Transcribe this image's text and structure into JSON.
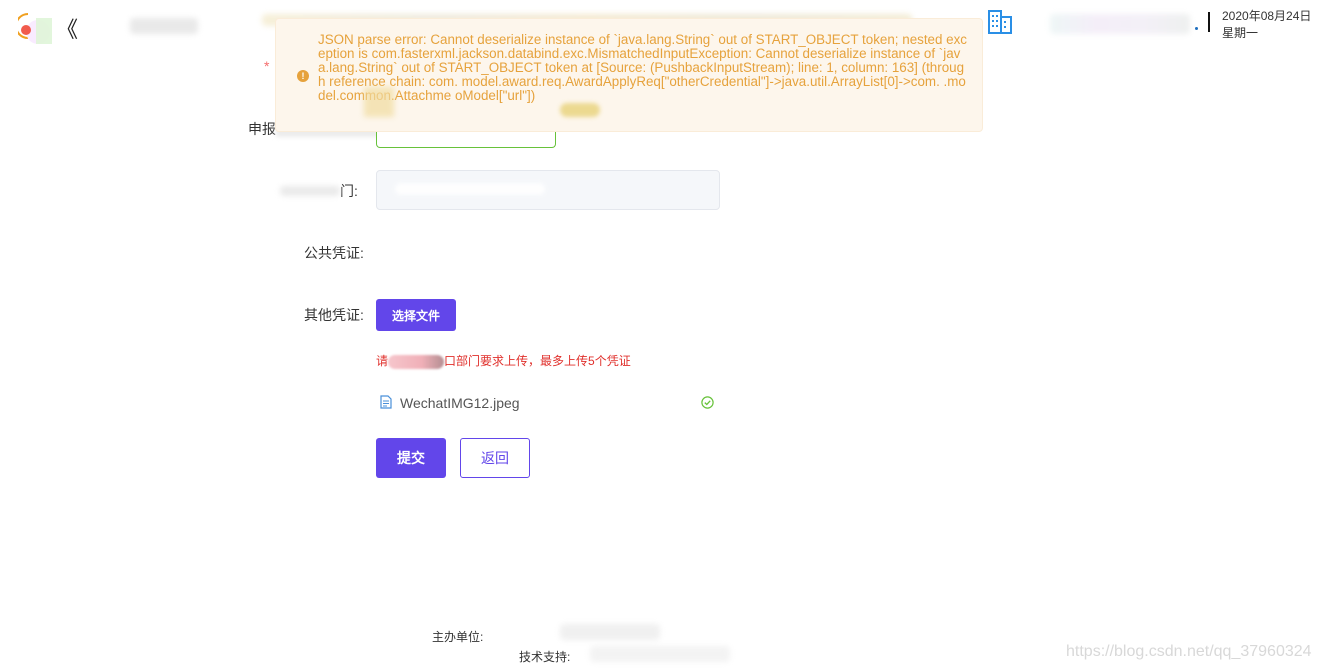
{
  "header": {
    "date": "2020年08月24日",
    "weekday": "星期一",
    "back_icon": "《"
  },
  "toast": {
    "type": "warning",
    "icon": "!",
    "message": "JSON parse error: Cannot deserialize instance of `java.lang.String` out of START_OBJECT token; nested exception is com.fasterxml.jackson.databind.exc.MismatchedInputException: Cannot deserialize instance of `java.lang.String` out of START_OBJECT token at [Source: (PushbackInputStream); line: 1, column: 163] (through reference chain: com.        model.award.req.AwardApplyReq[\"otherCredential\"]->java.util.ArrayList[0]->com.        .model.common.Attachme        oModel[\"url\"])"
  },
  "form": {
    "required_mark": "*",
    "amount_label": "申报",
    "amount_unit": "",
    "dept_label": "门:",
    "public_credential_label": "公共凭证:",
    "other_credential_label": "其他凭证:",
    "choose_file_label": "选择文件",
    "hint_prefix": "请",
    "hint_suffix": "口部门要求上传，最多上传5个凭证",
    "file_name": "WechatIMG12.jpeg",
    "file_status": "success",
    "submit_label": "提交",
    "back_label": "返回"
  },
  "footer": {
    "organizer_label": "主办单位:",
    "support_label": "技术支持:",
    "watermark": "https://blog.csdn.net/qq_37960324"
  },
  "colors": {
    "primary": "#6246ea",
    "warning": "#e6a23c",
    "success": "#67c23a",
    "error_text": "#e0302c"
  }
}
